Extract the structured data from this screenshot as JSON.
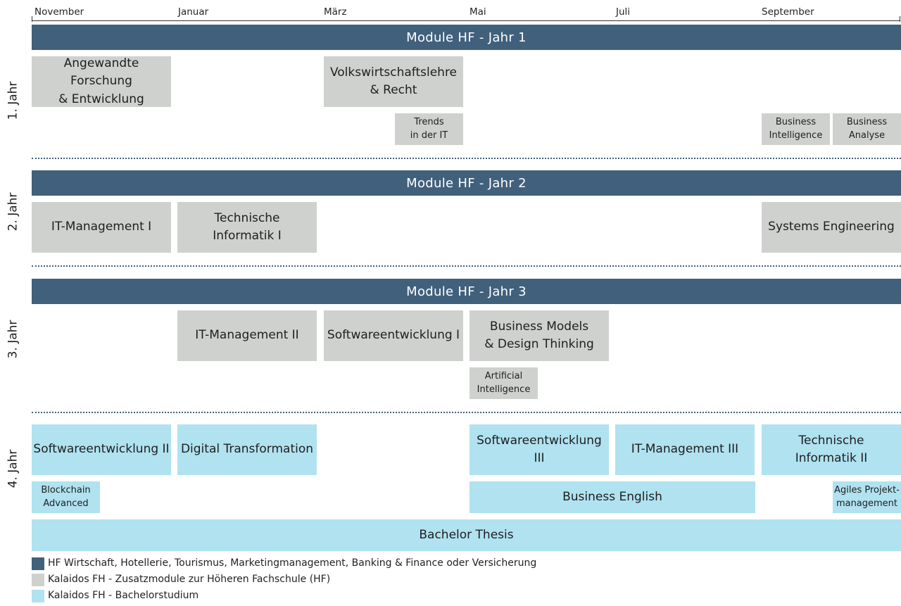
{
  "timeline": {
    "months": [
      "November",
      "Januar",
      "März",
      "Mai",
      "Juli",
      "September"
    ]
  },
  "years": [
    {
      "label": "1. Jahr",
      "hf_bar": "Module HF - Jahr 1"
    },
    {
      "label": "2. Jahr",
      "hf_bar": "Module HF - Jahr 2"
    },
    {
      "label": "3. Jahr",
      "hf_bar": "Module HF - Jahr 3"
    },
    {
      "label": "4. Jahr"
    }
  ],
  "modules": {
    "y1_forschung": "Angewandte Forschung\n& Entwicklung",
    "y1_vwl": "Volkswirtschaftslehre\n& Recht",
    "y1_trends": "Trends\nin der IT",
    "y1_bi": "Business\nIntelligence",
    "y1_ba": "Business\nAnalyse",
    "y2_itm1": "IT-Management I",
    "y2_ti1": "Technische\nInformatik I",
    "y2_se": "Systems Engineering",
    "y3_itm2": "IT-Management II",
    "y3_swe1": "Softwareentwicklung I",
    "y3_bm": "Business Models\n& Design Thinking",
    "y3_ai": "Artificial\nIntelligence",
    "y4_swe2": "Softwareentwicklung II",
    "y4_dt": "Digital Transformation",
    "y4_swe3": "Softwareentwicklung III",
    "y4_itm3": "IT-Management III",
    "y4_ti2": "Technische\nInformatik II",
    "y4_blockchain": "Blockchain\nAdvanced",
    "y4_english": "Business English",
    "y4_agile": "Agiles Projekt-\nmanagement",
    "y4_thesis": "Bachelor Thesis"
  },
  "legend": [
    {
      "color": "#41607c",
      "text": "HF Wirtschaft, Hotellerie, Tourismus, Marketingmanagement, Banking & Finance oder Versicherung"
    },
    {
      "color": "#cfd1cf",
      "text": "Kalaidos FH - Zusatzmodule zur Höheren Fachschule (HF)"
    },
    {
      "color": "#b0e2f0",
      "text": "Kalaidos FH - Bachelorstudium"
    }
  ],
  "colors": {
    "hf": "#41607c",
    "zusatzmodule": "#cfd1cf",
    "bachelor": "#b0e2f0"
  }
}
